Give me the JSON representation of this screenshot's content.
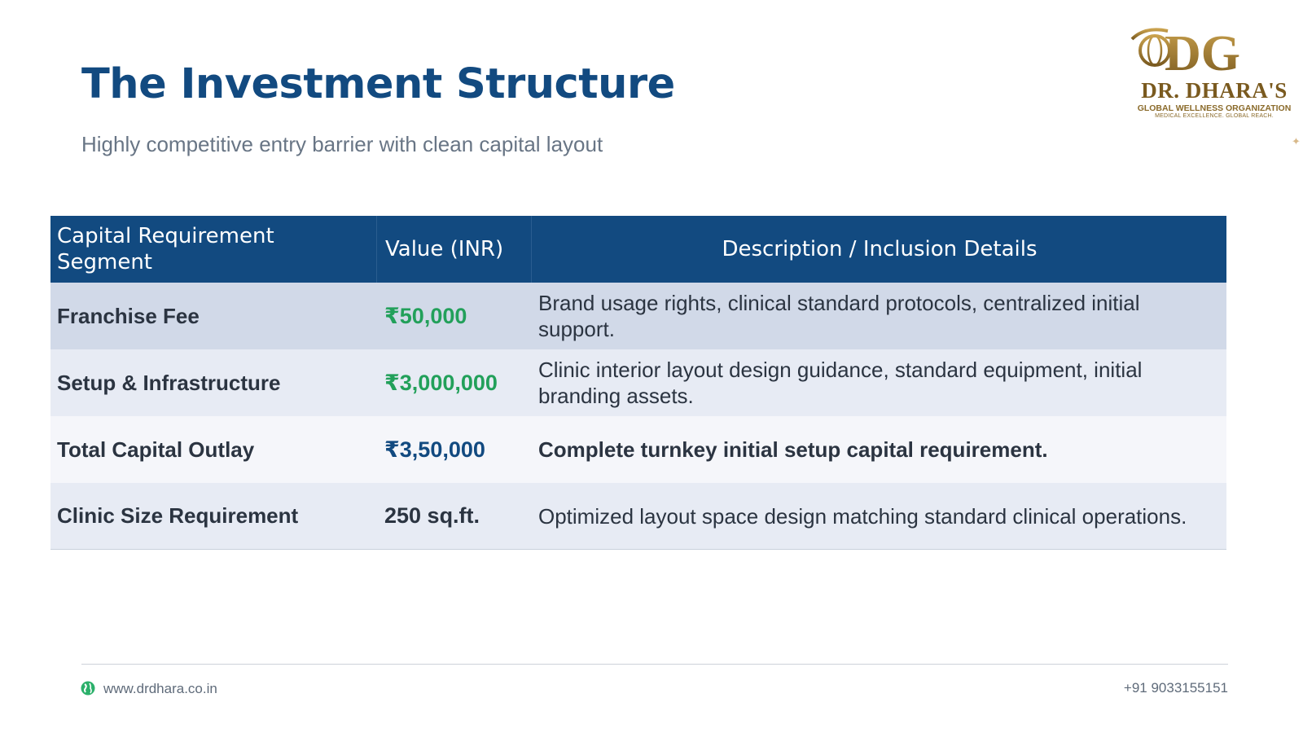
{
  "header": {
    "title": "The Investment Structure",
    "subtitle": "Highly competitive entry barrier with clean capital layout"
  },
  "logo": {
    "monogram": "DG",
    "name": "DR. DHARA'S",
    "org": "GLOBAL WELLNESS ORGANIZATION",
    "tagline": "MEDICAL EXCELLENCE. GLOBAL REACH.",
    "gold": "#9a7630"
  },
  "table": {
    "headers": [
      "Capital Requirement Segment",
      "Value (INR)",
      "Description / Inclusion Details"
    ],
    "rows": [
      {
        "segment": "Franchise Fee",
        "value": "₹50,000",
        "description": "Brand usage rights, clinical standard protocols, centralized initial support."
      },
      {
        "segment": "Setup & Infrastructure",
        "value": "₹3,000,000",
        "description": "Clinic interior layout design guidance, standard equipment, initial branding assets."
      },
      {
        "segment": "Total Capital Outlay",
        "value": "₹3,50,000",
        "description": "Complete turnkey initial setup capital requirement."
      },
      {
        "segment": "Clinic Size Requirement",
        "value": "250 sq.ft.",
        "description": "Optimized layout space design matching standard clinical operations."
      }
    ]
  },
  "colors": {
    "header_blue": "#124a80",
    "value_green": "#22a05a"
  },
  "footer": {
    "website": "www.drdhara.co.in",
    "phone": "+91 9033155151"
  }
}
